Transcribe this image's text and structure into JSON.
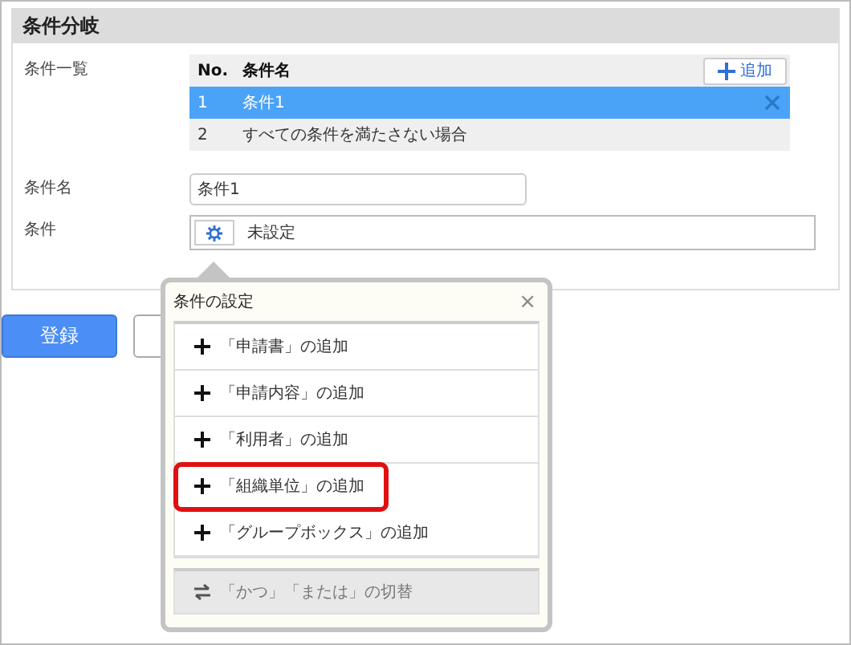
{
  "section": {
    "title": "条件分岐"
  },
  "condition_list": {
    "label": "条件一覧",
    "add_button": "追加",
    "columns": [
      "No.",
      "条件名"
    ],
    "rows": [
      {
        "no": "1",
        "name": "条件1",
        "selected": true,
        "removable": true
      },
      {
        "no": "2",
        "name": "すべての条件を満たさない場合",
        "selected": false,
        "removable": false
      }
    ]
  },
  "condition_name": {
    "label": "条件名",
    "value": "条件1"
  },
  "condition": {
    "label": "条件",
    "value": "未設定"
  },
  "register_button": "登録",
  "popup": {
    "title": "条件の設定",
    "close": "×",
    "items": [
      {
        "kind": "add",
        "label": "「申請書」の追加",
        "highlighted": false
      },
      {
        "kind": "add",
        "label": "「申請内容」の追加",
        "highlighted": false
      },
      {
        "kind": "add",
        "label": "「利用者」の追加",
        "highlighted": false
      },
      {
        "kind": "add",
        "label": "「組織単位」の追加",
        "highlighted": true
      },
      {
        "kind": "add",
        "label": "「グループボックス」の追加",
        "highlighted": false
      }
    ],
    "toggle": {
      "label": "「かつ」「または」の切替",
      "disabled": true
    }
  }
}
